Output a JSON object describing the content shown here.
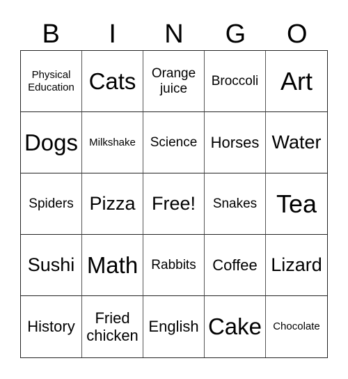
{
  "card": {
    "header": [
      "B",
      "I",
      "N",
      "G",
      "O"
    ],
    "rows": [
      [
        {
          "text": "Physical Education",
          "size": "xs"
        },
        {
          "text": "Cats",
          "size": "xl"
        },
        {
          "text": "Orange juice",
          "size": "s"
        },
        {
          "text": "Broccoli",
          "size": "s"
        },
        {
          "text": "Art",
          "size": "xxl"
        }
      ],
      [
        {
          "text": "Dogs",
          "size": "xl"
        },
        {
          "text": "Milkshake",
          "size": "xs"
        },
        {
          "text": "Science",
          "size": "s"
        },
        {
          "text": "Horses",
          "size": "m"
        },
        {
          "text": "Water",
          "size": "l"
        }
      ],
      [
        {
          "text": "Spiders",
          "size": "s"
        },
        {
          "text": "Pizza",
          "size": "l"
        },
        {
          "text": "Free!",
          "size": "l"
        },
        {
          "text": "Snakes",
          "size": "s"
        },
        {
          "text": "Tea",
          "size": "xxl"
        }
      ],
      [
        {
          "text": "Sushi",
          "size": "l"
        },
        {
          "text": "Math",
          "size": "xl"
        },
        {
          "text": "Rabbits",
          "size": "s"
        },
        {
          "text": "Coffee",
          "size": "m"
        },
        {
          "text": "Lizard",
          "size": "l"
        }
      ],
      [
        {
          "text": "History",
          "size": "m"
        },
        {
          "text": "Fried chicken",
          "size": "m"
        },
        {
          "text": "English",
          "size": "m"
        },
        {
          "text": "Cake",
          "size": "xl"
        },
        {
          "text": "Chocolate",
          "size": "xs"
        }
      ]
    ]
  }
}
